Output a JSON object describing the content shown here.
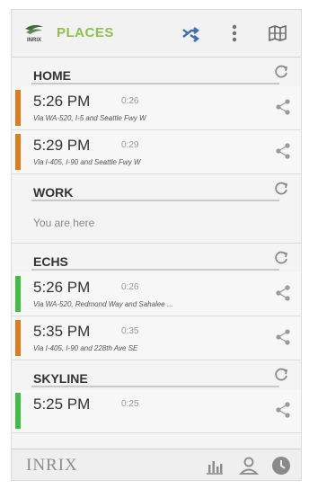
{
  "header": {
    "title": "PLACES",
    "logo_text": "INRIX"
  },
  "colors": {
    "accent_green": "#8bc34a",
    "delay_orange": "#e07b1a",
    "clear_green": "#3ec13e"
  },
  "sections": [
    {
      "title": "HOME",
      "routes": [
        {
          "time": "5:26 PM",
          "duration": "0:26",
          "via": "Via WA-520, I-5 and Seattle Fwy W",
          "status": "orange"
        },
        {
          "time": "5:29 PM",
          "duration": "0:29",
          "via": "Via I-405, I-90 and Seattle Fwy W",
          "status": "orange"
        }
      ]
    },
    {
      "title": "WORK",
      "message": "You are here"
    },
    {
      "title": "ECHS",
      "routes": [
        {
          "time": "5:26 PM",
          "duration": "0:26",
          "via": "Via WA-520, Redmond Way and Sahalee ...",
          "status": "green"
        },
        {
          "time": "5:35 PM",
          "duration": "0:35",
          "via": "Via I-405, I-90 and 228th Ave SE",
          "status": "orange"
        }
      ]
    },
    {
      "title": "SKYLINE",
      "routes": [
        {
          "time": "5:25 PM",
          "duration": "0:25",
          "via": "",
          "status": "green"
        }
      ]
    }
  ],
  "footer": {
    "brand": "INRIX"
  },
  "icons": [
    "shuffle-icon",
    "overflow-menu-icon",
    "map-icon",
    "refresh-icon",
    "share-icon",
    "stats-icon",
    "profile-icon",
    "clock-icon"
  ]
}
